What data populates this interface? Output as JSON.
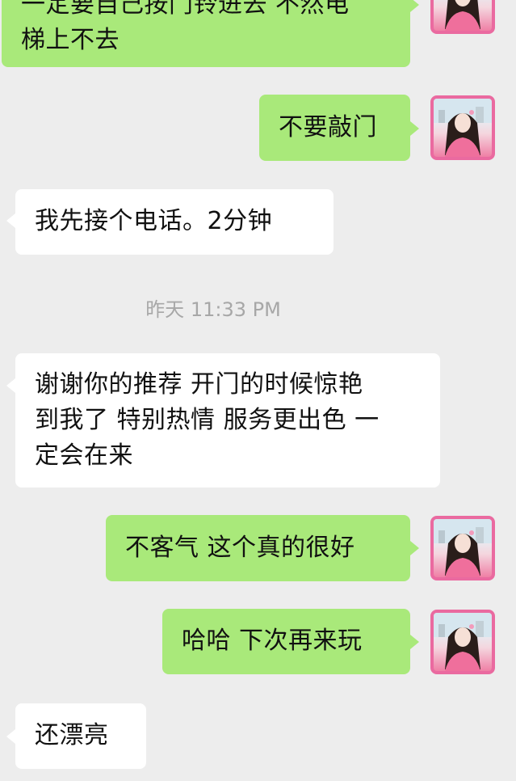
{
  "colors": {
    "background": "#ededed",
    "sent_bubble": "#a9e97a",
    "received_bubble": "#ffffff",
    "avatar_border": "#ea6aa0",
    "timestamp_text": "#a7a7a7"
  },
  "messages": [
    {
      "side": "sent",
      "lines": [
        "一定要自己按门铃进去 不然电",
        "梯上不去"
      ],
      "avatar": "avatar-icon"
    },
    {
      "side": "sent",
      "lines": [
        "不要敲门"
      ],
      "avatar": "avatar-icon"
    },
    {
      "side": "received",
      "lines": [
        "我先接个电话。2分钟"
      ]
    },
    {
      "side": "received",
      "lines": [
        "谢谢你的推荐 开门的时候惊艳",
        "到我了 特别热情 服务更出色 一",
        "定会在来"
      ]
    },
    {
      "side": "sent",
      "lines": [
        "不客气 这个真的很好"
      ],
      "avatar": "avatar-icon"
    },
    {
      "side": "sent",
      "lines": [
        "哈哈 下次再来玩"
      ],
      "avatar": "avatar-icon"
    },
    {
      "side": "received",
      "lines": [
        "还漂亮"
      ]
    }
  ],
  "timestamp": "昨天 11:33 PM"
}
